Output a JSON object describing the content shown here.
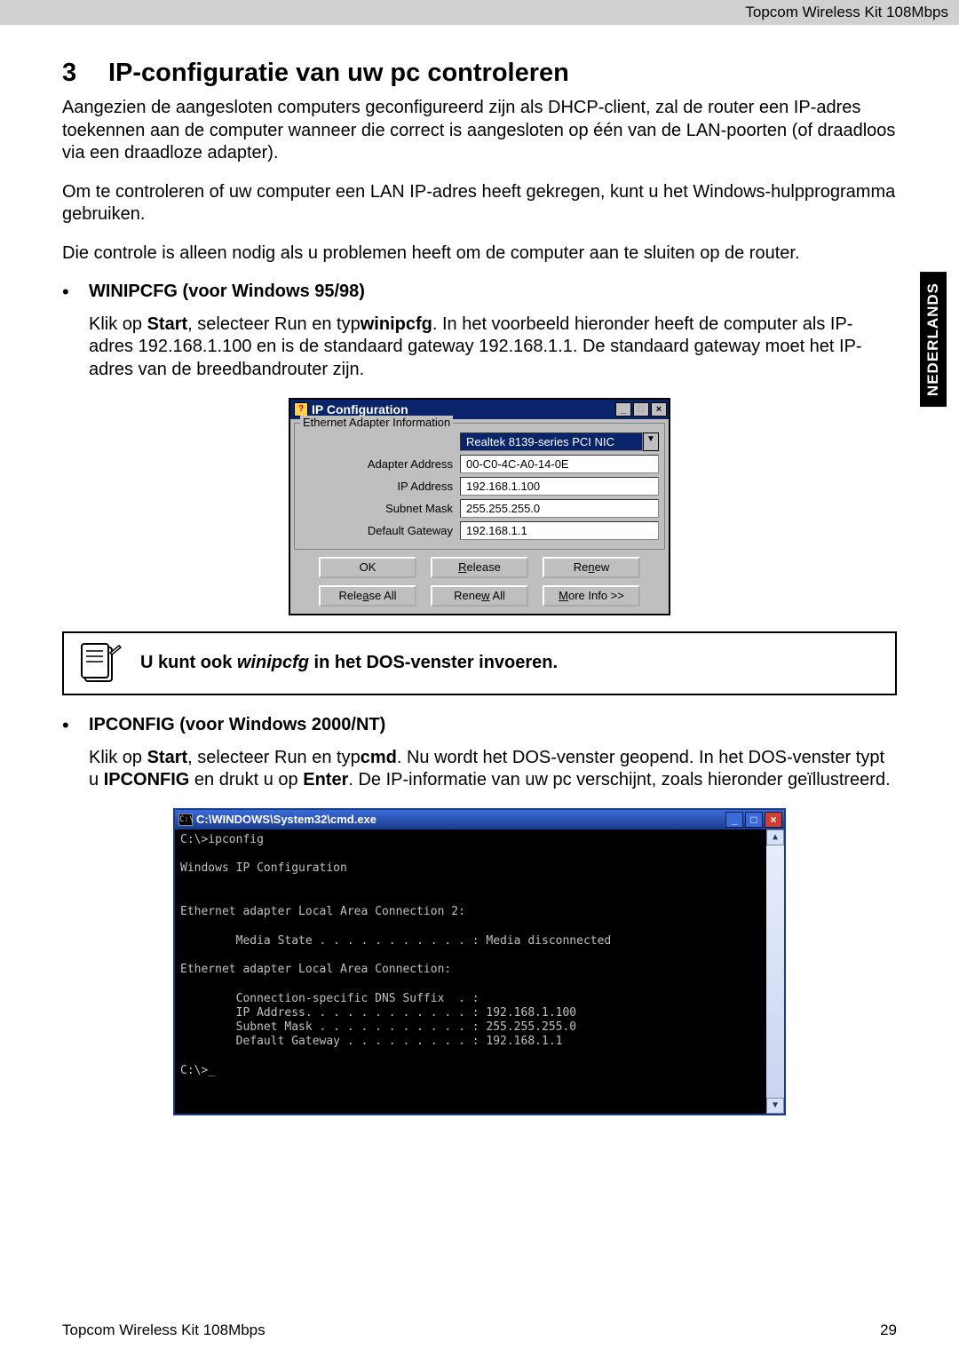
{
  "header_right": "Topcom Wireless Kit 108Mbps",
  "side_tab": "NEDERLANDS",
  "chapter_number": "3",
  "chapter_title": "IP-configuratie van uw pc controleren",
  "p1": "Aangezien de aangesloten computers geconfigureerd zijn als DHCP-client, zal de router een IP-adres toekennen aan de computer wanneer die correct is aangesloten op één van de LAN-poorten (of draadloos via een draadloze adapter).",
  "p2": "Om te controleren of uw computer een LAN IP-adres heeft gekregen, kunt u het Windows-hulpprogramma gebruiken.",
  "p3": "Die controle is alleen nodig als u problemen heeft om de computer aan te sluiten op de router.",
  "bullet1_title": "WINIPCFG (voor Windows 95/98)",
  "bullet1_body_pre": "Klik op ",
  "bullet1_body_bold1": "Start",
  "bullet1_body_mid1": ", selecteer Run en typ",
  "bullet1_body_bold2": "winipcfg",
  "bullet1_body_mid2": ". In het voorbeeld hieronder heeft de computer als IP- adres 192.168.1.100 en is de standaard gateway 192.168.1.1. De standaard gateway moet het IP-adres van de breedbandrouter zijn.",
  "ipcfg": {
    "title": "IP Configuration",
    "group_legend": "Ethernet Adapter Information",
    "adapter_combo": "Realtek 8139-series PCI NIC",
    "rows": [
      {
        "label": "Adapter Address",
        "value": "00-C0-4C-A0-14-0E"
      },
      {
        "label": "IP Address",
        "value": "192.168.1.100"
      },
      {
        "label": "Subnet Mask",
        "value": "255.255.255.0"
      },
      {
        "label": "Default Gateway",
        "value": "192.168.1.1"
      }
    ],
    "btn_ok": "OK",
    "btn_release": "Release",
    "btn_renew": "Renew",
    "btn_release_all": "Release All",
    "btn_renew_all": "Renew All",
    "btn_more": "More Info >>"
  },
  "note_pre": "U kunt ook ",
  "note_italic": "winipcfg",
  "note_post": " in het DOS-venster invoeren.",
  "bullet2_title": "IPCONFIG (voor Windows 2000/NT)",
  "bullet2_body": {
    "a": "Klik op ",
    "b1": "Start",
    "c": ", selecteer Run en typ",
    "b2": "cmd",
    "d": ". Nu wordt het DOS-venster geopend. In het DOS-venster typt u ",
    "b3": "IPCONFIG",
    "e": " en drukt u op ",
    "b4": "Enter",
    "f": ". De IP-informatie van uw pc verschijnt, zoals hieronder geïllustreerd."
  },
  "cmd": {
    "title": "C:\\WINDOWS\\System32\\cmd.exe",
    "lines": [
      "C:\\>ipconfig",
      "",
      "Windows IP Configuration",
      "",
      "",
      "Ethernet adapter Local Area Connection 2:",
      "",
      "        Media State . . . . . . . . . . . : Media disconnected",
      "",
      "Ethernet adapter Local Area Connection:",
      "",
      "        Connection-specific DNS Suffix  . :",
      "        IP Address. . . . . . . . . . . . : 192.168.1.100",
      "        Subnet Mask . . . . . . . . . . . : 255.255.255.0",
      "        Default Gateway . . . . . . . . . : 192.168.1.1",
      "",
      "C:\\>_"
    ]
  },
  "footer_left": "Topcom Wireless Kit 108Mbps",
  "footer_right": "29"
}
